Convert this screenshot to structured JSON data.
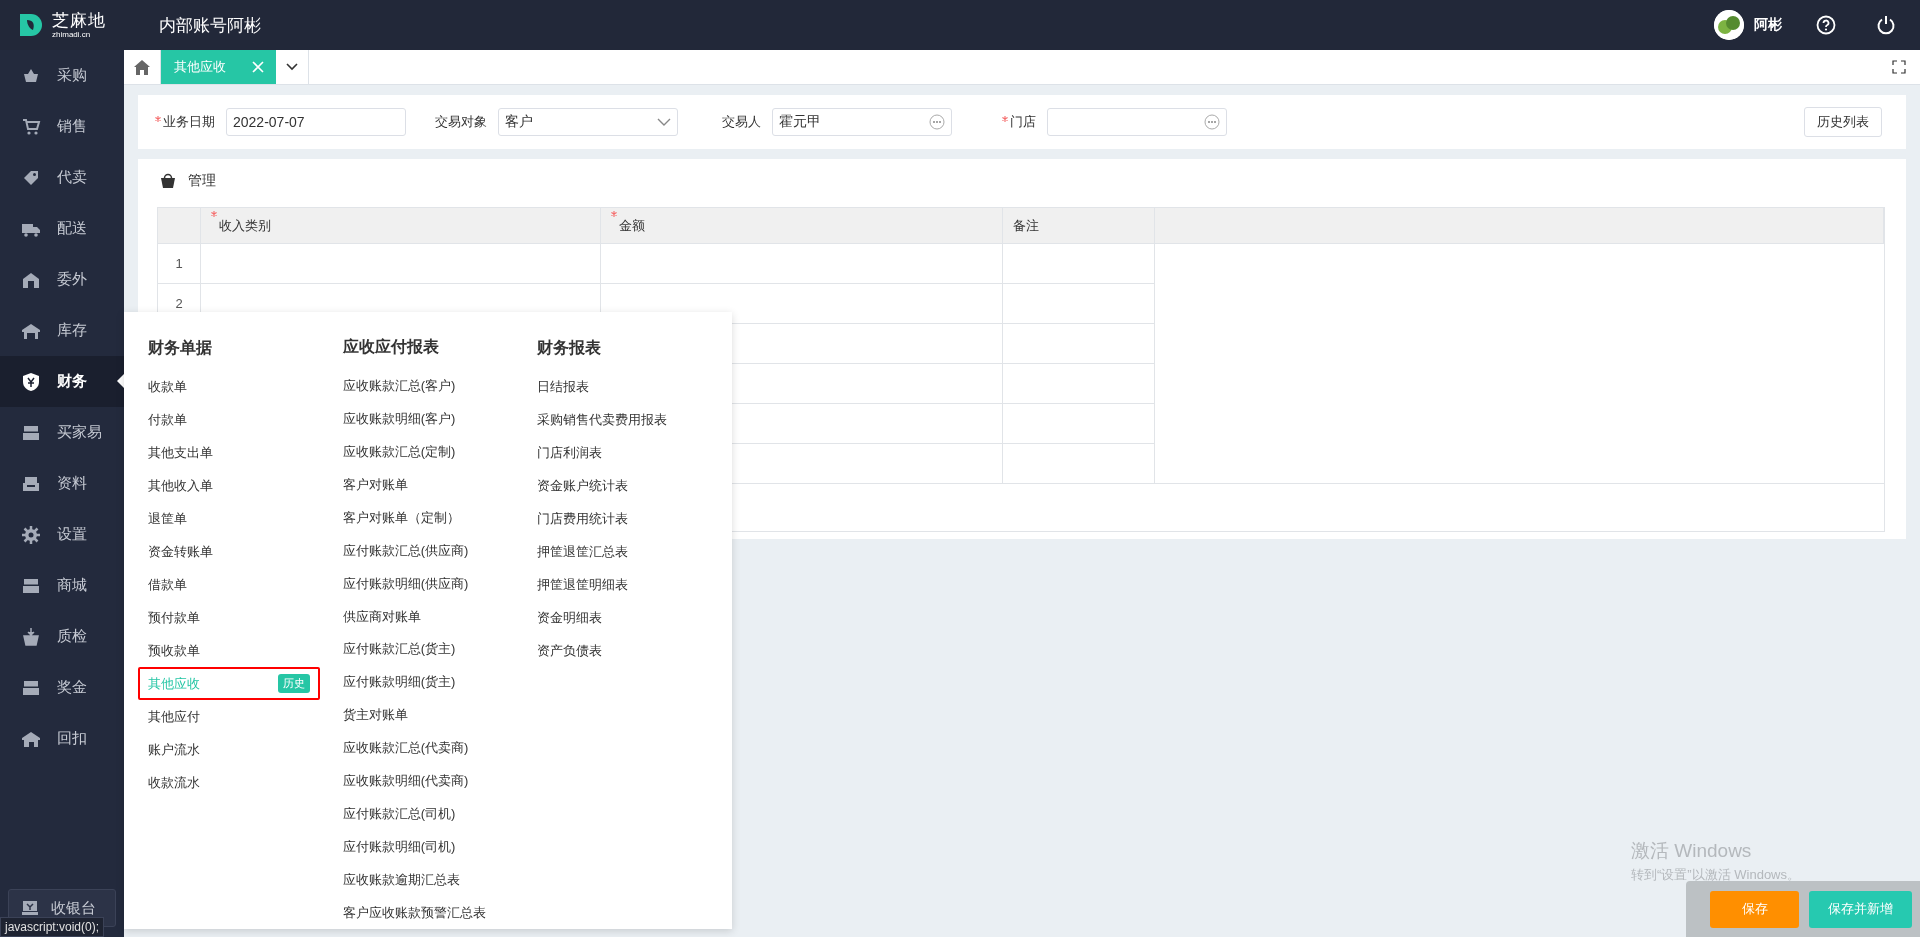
{
  "header": {
    "logo_text": "芝麻地",
    "logo_sub": "zhimadi.cn",
    "account": "内部账号阿彬",
    "user": "阿彬"
  },
  "sidebar": {
    "items": [
      {
        "label": "采购",
        "selected": false
      },
      {
        "label": "销售",
        "selected": false
      },
      {
        "label": "代卖",
        "selected": false
      },
      {
        "label": "配送",
        "selected": false
      },
      {
        "label": "委外",
        "selected": false
      },
      {
        "label": "库存",
        "selected": false
      },
      {
        "label": "财务",
        "selected": true
      },
      {
        "label": "买家易",
        "selected": false
      },
      {
        "label": "资料",
        "selected": false
      },
      {
        "label": "设置",
        "selected": false
      },
      {
        "label": "商城",
        "selected": false
      },
      {
        "label": "质检",
        "selected": false
      },
      {
        "label": "奖金",
        "selected": false
      },
      {
        "label": "回扣",
        "selected": false
      }
    ],
    "cashier": "收银台"
  },
  "tabs": [
    {
      "label": "其他应收",
      "selected": true
    }
  ],
  "form": {
    "fields": [
      {
        "label": "业务日期",
        "required": true,
        "kind": "text",
        "value": "2022-07-07"
      },
      {
        "label": "交易对象",
        "required": false,
        "kind": "select",
        "value": "客户"
      },
      {
        "label": "交易人",
        "required": false,
        "kind": "lookup",
        "value": "霍元甲"
      },
      {
        "label": "门店",
        "required": true,
        "kind": "lookup"
      }
    ],
    "history_button": "历史列表"
  },
  "section": {
    "title": "管理",
    "table": {
      "columns": [
        {
          "label": "收入类别",
          "required": true
        },
        {
          "label": "金额",
          "required": true
        },
        {
          "label": "备注",
          "required": false
        }
      ],
      "rows": [
        {
          "number": "1"
        },
        {
          "number": "2"
        },
        {},
        {},
        {},
        {}
      ]
    }
  },
  "menu": {
    "columns": [
      {
        "title": "财务单据",
        "items": [
          {
            "label": "收款单",
            "selected": false
          },
          {
            "label": "付款单",
            "selected": false
          },
          {
            "label": "其他支出单",
            "selected": false
          },
          {
            "label": "其他收入单",
            "selected": false
          },
          {
            "label": "退筐单",
            "selected": false
          },
          {
            "label": "资金转账单",
            "selected": false
          },
          {
            "label": "借款单",
            "selected": false
          },
          {
            "label": "预付款单",
            "selected": false
          },
          {
            "label": "预收款单",
            "selected": false
          },
          {
            "label": "其他应收",
            "selected": true,
            "badge": "历史"
          },
          {
            "label": "其他应付",
            "selected": false
          },
          {
            "label": "账户流水",
            "selected": false
          },
          {
            "label": "收款流水",
            "selected": false
          }
        ]
      },
      {
        "title": "应收应付报表",
        "items": [
          {
            "label": "应收账款汇总(客户)",
            "selected": false
          },
          {
            "label": "应收账款明细(客户)",
            "selected": false
          },
          {
            "label": "应收账款汇总(定制)",
            "selected": false
          },
          {
            "label": "客户对账单",
            "selected": false
          },
          {
            "label": "客户对账单（定制）",
            "selected": false
          },
          {
            "label": "应付账款汇总(供应商)",
            "selected": false
          },
          {
            "label": "应付账款明细(供应商)",
            "selected": false
          },
          {
            "label": "供应商对账单",
            "selected": false
          },
          {
            "label": "应付账款汇总(货主)",
            "selected": false
          },
          {
            "label": "应付账款明细(货主)",
            "selected": false
          },
          {
            "label": "货主对账单",
            "selected": false
          },
          {
            "label": "应收账款汇总(代卖商)",
            "selected": false
          },
          {
            "label": "应收账款明细(代卖商)",
            "selected": false
          },
          {
            "label": "应付账款汇总(司机)",
            "selected": false
          },
          {
            "label": "应付账款明细(司机)",
            "selected": false
          },
          {
            "label": "应收账款逾期汇总表",
            "selected": false
          },
          {
            "label": "客户应收账款预警汇总表",
            "selected": false
          }
        ]
      },
      {
        "title": "财务报表",
        "items": [
          {
            "label": "日结报表",
            "selected": false
          },
          {
            "label": "采购销售代卖费用报表",
            "selected": false
          },
          {
            "label": "门店利润表",
            "selected": false
          },
          {
            "label": "资金账户统计表",
            "selected": false
          },
          {
            "label": "门店费用统计表",
            "selected": false
          },
          {
            "label": "押筐退筐汇总表",
            "selected": false
          },
          {
            "label": "押筐退筐明细表",
            "selected": false
          },
          {
            "label": "资金明细表",
            "selected": false
          },
          {
            "label": "资产负债表",
            "selected": false
          }
        ]
      }
    ]
  },
  "windows_notice": {
    "title": "激活 Windows",
    "text": "转到“设置”以激活 Windows。"
  },
  "actions": [
    {
      "label": "保存",
      "kind": "primary"
    },
    {
      "label": "保存并新增",
      "kind": "secondary"
    }
  ],
  "status_bar": "javascript:void(0);"
}
